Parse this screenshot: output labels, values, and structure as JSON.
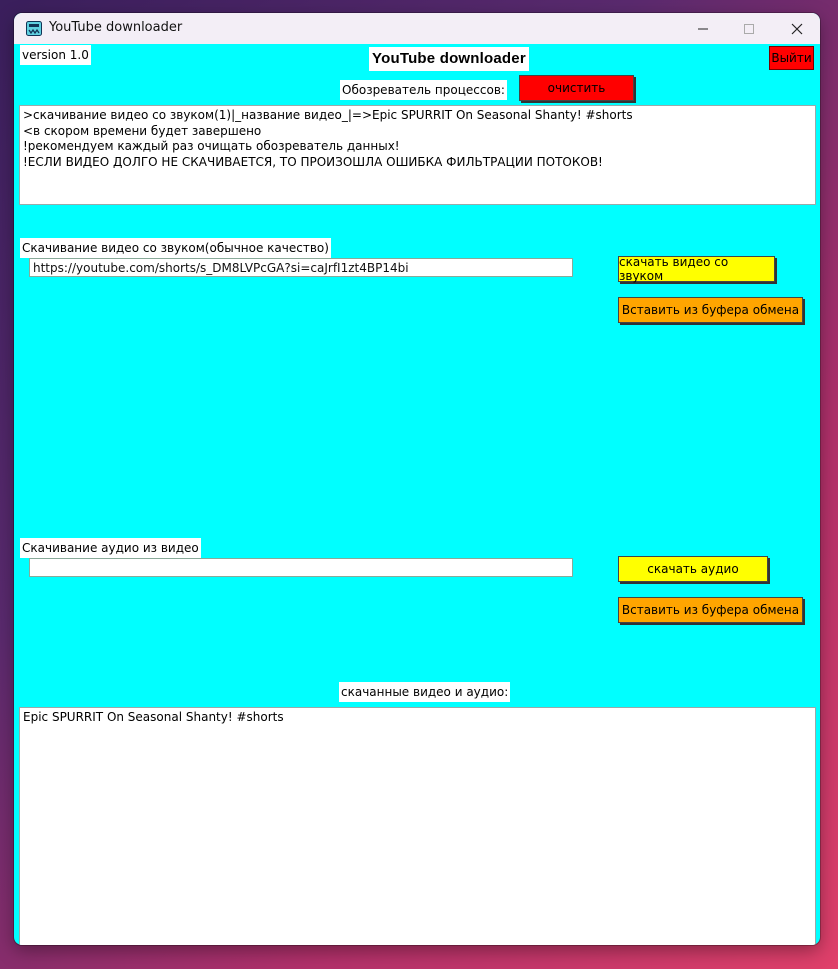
{
  "window": {
    "title": "YouTube downloader",
    "controls": {
      "minimize": "–",
      "maximize": "□",
      "close": "✕"
    }
  },
  "header": {
    "version": "version 1.0",
    "heading": "YouTube downloader",
    "exit_label": "Выйти"
  },
  "process_viewer": {
    "label": "Обозреватель процессов:",
    "clear_label": "очистить",
    "lines": [
      ">скачивание видео со звуком(1)|_название видео_|=>Epic SPURRIT On Seasonal Shanty! #shorts",
      "<в скором времени будет завершено",
      "!рекомендуем каждый раз очищать обозреватель данных!",
      "!ЕСЛИ ВИДЕО ДОЛГО НЕ СКАЧИВАЕТСЯ, ТО ПРОИЗОШЛА ОШИБКА ФИЛЬТРАЦИИ ПОТОКОВ!"
    ]
  },
  "video_section": {
    "label": "Скачивание видео со звуком(обычное качество)",
    "url_value": "https://youtube.com/shorts/s_DM8LVPcGA?si=caJrfI1zt4BP14bi",
    "download_label": "скачать видео со звуком",
    "paste_label": "Вставить из буфера обмена"
  },
  "audio_section": {
    "label": "Скачивание аудио из видео",
    "url_value": "",
    "download_label": "скачать аудио",
    "paste_label": "Вставить из буфера обмена"
  },
  "downloads": {
    "label": "скачанные видео и аудио:",
    "items": [
      "Epic SPURRIT On Seasonal Shanty! #shorts"
    ]
  },
  "colors": {
    "background": "#00ffff",
    "exit_button": "#ff0000",
    "clear_button": "#ff0000",
    "download_button": "#ffff00",
    "paste_button": "#ffa500"
  }
}
